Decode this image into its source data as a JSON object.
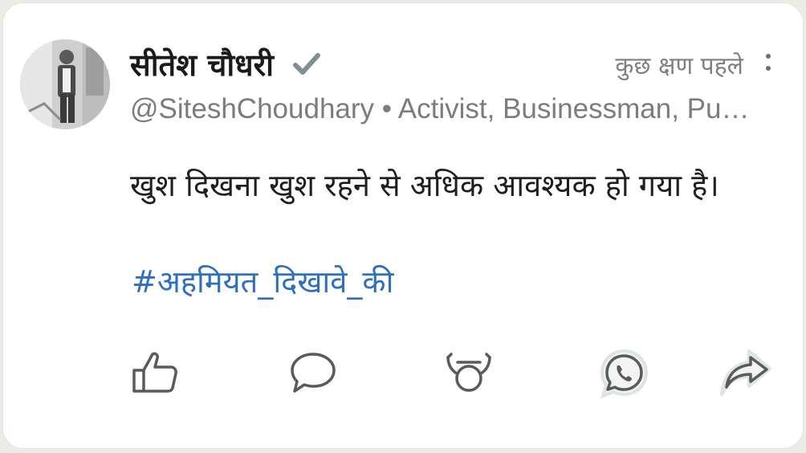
{
  "post": {
    "author_name": "सीतेश चौधरी",
    "verified_icon": "verified-check-icon",
    "timestamp": "कुछ क्षण पहले",
    "handle_bio": "@SiteshChoudhary • Activist, Businessman, Public Speaker",
    "text": "खुश दिखना खुश रहने से अधिक आवश्यक हो गया है।",
    "hashtag": "#अहमियत_दिखावे_की"
  },
  "actions": [
    {
      "name": "like",
      "icon": "thumbs-up-icon"
    },
    {
      "name": "comment",
      "icon": "speech-bubble-icon"
    },
    {
      "name": "react",
      "icon": "bull-face-icon"
    },
    {
      "name": "whatsapp",
      "icon": "whatsapp-icon"
    },
    {
      "name": "share",
      "icon": "share-arrow-icon"
    }
  ],
  "colors": {
    "hashtag": "#2f6fc0",
    "verified": "#7e9096",
    "secondary_text": "#7c7c7c",
    "icon_stroke": "#5a5a5a"
  }
}
